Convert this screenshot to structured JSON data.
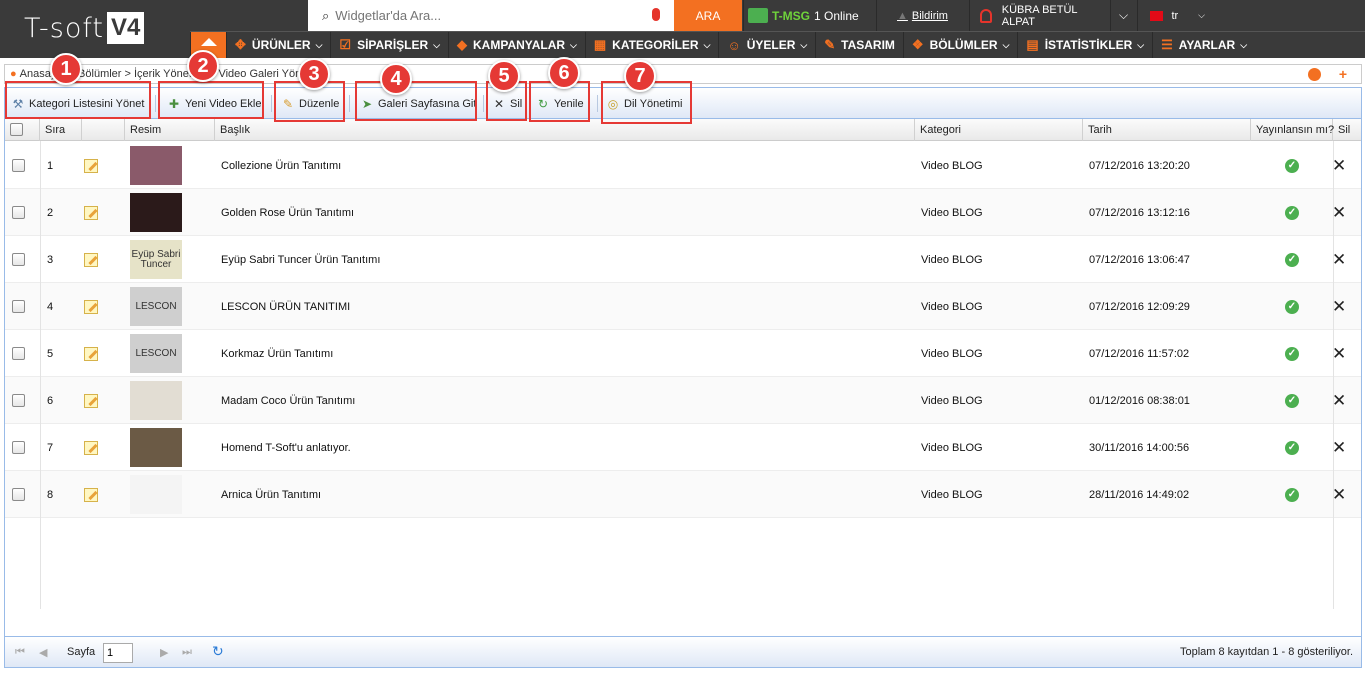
{
  "brand": {
    "logo_text": "T-soft",
    "logo_badge": "V4"
  },
  "search": {
    "placeholder": "Widgetlar'da Ara...",
    "button": "ARA"
  },
  "topbar": {
    "tmsg_label": "T-MSG",
    "tmsg_status": "1 Online",
    "notifications": "Bildirim",
    "user": "KÜBRA BETÜL ALPAT",
    "lang": "tr"
  },
  "nav": [
    "ÜRÜNLER",
    "SİPARİŞLER",
    "KAMPANYALAR",
    "KATEGORİLER",
    "ÜYELER",
    "TASARIM",
    "BÖLÜMLER",
    "İSTATİSTİKLER",
    "AYARLAR"
  ],
  "breadcrumb": "Anasayfa > Bölümler > İçerik Yönetimi > Video Galeri Yönetimi",
  "toolbar": {
    "manage_categories": "Kategori Listesini Yönet",
    "add_video": "Yeni Video Ekle",
    "edit": "Düzenle",
    "go_gallery": "Galeri Sayfasına Git",
    "delete": "Sil",
    "refresh": "Yenile",
    "language": "Dil Yönetimi"
  },
  "columns": {
    "order": "Sıra",
    "image": "Resim",
    "title": "Başlık",
    "category": "Kategori",
    "date": "Tarih",
    "published": "Yayınlansın mı?",
    "delete": "Sil"
  },
  "rows": [
    {
      "order": "1",
      "title": "Collezione Ürün Tanıtımı",
      "category": "Video BLOG",
      "date": "07/12/2016 13:20:20",
      "thumb": "#8a5a6a"
    },
    {
      "order": "2",
      "title": "Golden Rose Ürün Tanıtımı",
      "category": "Video BLOG",
      "date": "07/12/2016 13:12:16",
      "thumb": "#2b1a1a"
    },
    {
      "order": "3",
      "title": "Eyüp Sabri Tuncer Ürün Tanıtımı",
      "category": "Video BLOG",
      "date": "07/12/2016 13:06:47",
      "thumb": "#e6e3c8",
      "thumb_text": "Eyüp Sabri Tuncer"
    },
    {
      "order": "4",
      "title": "LESCON ÜRÜN TANITIMI",
      "category": "Video BLOG",
      "date": "07/12/2016 12:09:29",
      "thumb": "#cfcfcf",
      "thumb_text": "LESCON"
    },
    {
      "order": "5",
      "title": "Korkmaz Ürün Tanıtımı",
      "category": "Video BLOG",
      "date": "07/12/2016 11:57:02",
      "thumb": "#cfcfcf",
      "thumb_text": "LESCON"
    },
    {
      "order": "6",
      "title": "Madam Coco Ürün Tanıtımı",
      "category": "Video BLOG",
      "date": "01/12/2016 08:38:01",
      "thumb": "#e2ddd3"
    },
    {
      "order": "7",
      "title": "Homend T-Soft'u anlatıyor.",
      "category": "Video BLOG",
      "date": "30/11/2016 14:00:56",
      "thumb": "#6b5a45"
    },
    {
      "order": "8",
      "title": "Arnica Ürün Tanıtımı",
      "category": "Video BLOG",
      "date": "28/11/2016 14:49:02",
      "thumb": "#f4f4f4"
    }
  ],
  "pager": {
    "label": "Sayfa",
    "page": "1",
    "info": "Toplam 8 kayıtdan 1 - 8 gösteriliyor."
  },
  "annotations": [
    "1",
    "2",
    "3",
    "4",
    "5",
    "6",
    "7"
  ],
  "colors": {
    "accent": "#f37021",
    "topbar": "#3a3a3a",
    "annotation": "#e53935",
    "ok": "#4caf50"
  }
}
